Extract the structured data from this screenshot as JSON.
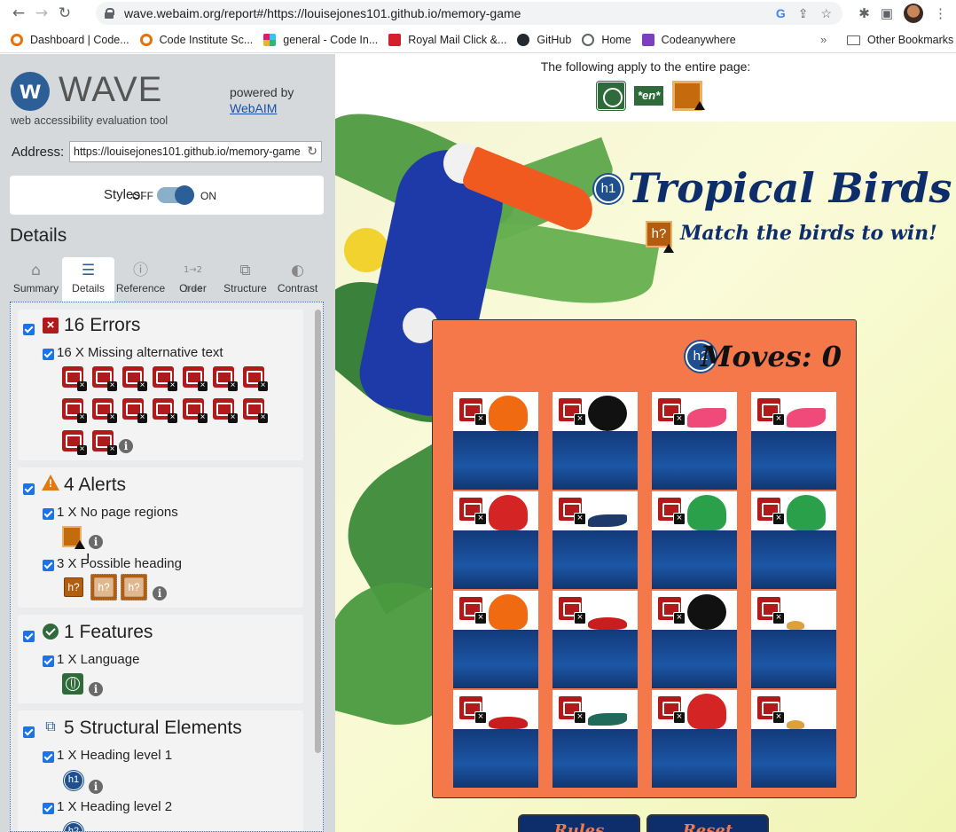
{
  "browser": {
    "url": "wave.webaim.org/report#/https://louisejones101.github.io/memory-game",
    "bookmarks": [
      "Dashboard | Code...",
      "Code Institute Sc...",
      "general - Code In...",
      "Royal Mail Click &...",
      "GitHub",
      "Home",
      "Codeanywhere"
    ],
    "bookmark_colors": [
      "#e8710a",
      "#e8710a",
      "#4a154b",
      "#d4202c",
      "#24292f",
      "#5f6368",
      "#7b3fbf"
    ],
    "more": "»",
    "other_bookmarks": "Other Bookmarks"
  },
  "wave": {
    "logo_text": "WAVE",
    "logo_sub": "web accessibility evaluation tool",
    "powered_by": "powered by",
    "webaim": "WebAIM",
    "address_label": "Address:",
    "address_value": "https://louisejones101.github.io/memory-game",
    "styles_label": "Styles:",
    "off": "OFF",
    "on": "ON",
    "details_heading": "Details",
    "tabs": [
      "Summary",
      "Details",
      "Reference",
      "Order",
      "Structure",
      "Contrast"
    ],
    "errors": {
      "title": "16 Errors",
      "item": "16 X Missing alternative text"
    },
    "alerts": {
      "title": "4 Alerts",
      "item1": "1 X No page regions",
      "item2": "3 X Possible heading"
    },
    "features": {
      "title": "1 Features",
      "item": "1 X Language"
    },
    "structure": {
      "title": "5 Structural Elements",
      "item1": "1 X Heading level 1",
      "item2": "1 X Heading level 2"
    }
  },
  "preview": {
    "apply_text": "The following apply to the entire page:",
    "lang_tag": "*en*",
    "title": "Tropical Birds",
    "subtitle": "Match the birds to win!",
    "moves_label": "Moves:",
    "moves_value": "0",
    "h1": "h1",
    "h2": "h2",
    "hq": "h?",
    "buttons": [
      "Rules",
      "Reset"
    ]
  }
}
